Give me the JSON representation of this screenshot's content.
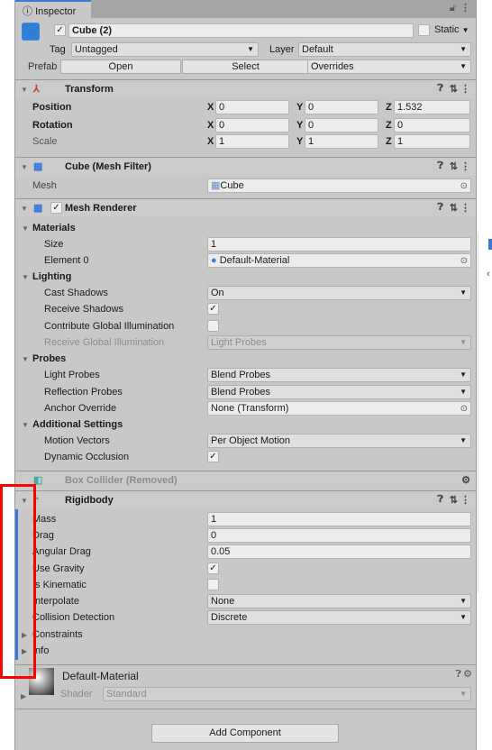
{
  "tab": {
    "title": "Inspector"
  },
  "object": {
    "name": "Cube (2)",
    "active": true,
    "static_label": "Static",
    "tag_label": "Tag",
    "tag": "Untagged",
    "layer_label": "Layer",
    "layer": "Default",
    "prefab_label": "Prefab",
    "open": "Open",
    "select": "Select",
    "overrides": "Overrides"
  },
  "transform": {
    "title": "Transform",
    "rows": [
      {
        "label": "Position",
        "x": "0",
        "y": "0",
        "z": "1.532"
      },
      {
        "label": "Rotation",
        "x": "0",
        "y": "0",
        "z": "0"
      },
      {
        "label": "Scale",
        "x": "1",
        "y": "1",
        "z": "1"
      }
    ]
  },
  "mesh_filter": {
    "title": "Cube (Mesh Filter)",
    "mesh_label": "Mesh",
    "mesh": "Cube"
  },
  "mesh_renderer": {
    "title": "Mesh Renderer",
    "enabled": true,
    "rows": [
      {
        "label": "Materials",
        "type": "section"
      },
      {
        "label": "Size",
        "type": "field",
        "value": "1"
      },
      {
        "label": "Element 0",
        "type": "object",
        "value": "Default-Material"
      },
      {
        "label": "Lighting",
        "type": "section"
      },
      {
        "label": "Cast Shadows",
        "type": "dropdown",
        "value": "On"
      },
      {
        "label": "Receive Shadows",
        "type": "check",
        "value": true
      },
      {
        "label": "Contribute Global Illumination",
        "type": "check",
        "value": false
      },
      {
        "label": "Receive Global Illumination",
        "type": "dropdown",
        "value": "Light Probes",
        "disabled": true
      },
      {
        "label": "Probes",
        "type": "section"
      },
      {
        "label": "Light Probes",
        "type": "dropdown",
        "value": "Blend Probes"
      },
      {
        "label": "Reflection Probes",
        "type": "dropdown",
        "value": "Blend Probes"
      },
      {
        "label": "Anchor Override",
        "type": "object",
        "value": "None (Transform)"
      },
      {
        "label": "Additional Settings",
        "type": "section"
      },
      {
        "label": "Motion Vectors",
        "type": "dropdown",
        "value": "Per Object Motion"
      },
      {
        "label": "Dynamic Occlusion",
        "type": "check",
        "value": true
      }
    ]
  },
  "box_collider": {
    "title": "Box Collider (Removed)"
  },
  "rigidbody": {
    "title": "Rigidbody",
    "rows": [
      {
        "label": "Mass",
        "type": "field",
        "value": "1"
      },
      {
        "label": "Drag",
        "type": "field",
        "value": "0"
      },
      {
        "label": "Angular Drag",
        "type": "field",
        "value": "0.05"
      },
      {
        "label": "Use Gravity",
        "type": "check",
        "value": true
      },
      {
        "label": "Is Kinematic",
        "type": "check",
        "value": false
      },
      {
        "label": "Interpolate",
        "type": "dropdown",
        "value": "None"
      },
      {
        "label": "Collision Detection",
        "type": "dropdown",
        "value": "Discrete"
      },
      {
        "label": "Constraints",
        "type": "foldout"
      },
      {
        "label": "Info",
        "type": "foldout"
      }
    ]
  },
  "material": {
    "name": "Default-Material",
    "shader_label": "Shader",
    "shader": "Standard"
  },
  "add_component": "Add Component",
  "colors": {
    "accent": "#3a79d8",
    "highlight": "#ff0000",
    "panel": "#c8c8c8"
  }
}
